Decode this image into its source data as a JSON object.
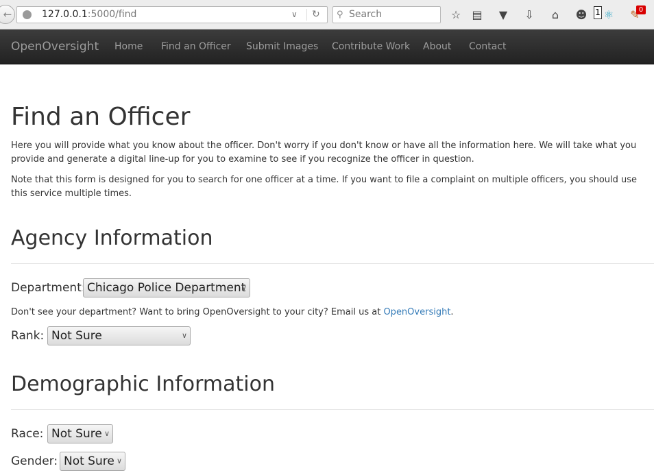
{
  "browser": {
    "url_host": "127.0.0.1",
    "url_rest": ":5000/find",
    "search_placeholder": "Search",
    "tab_count_badge": "1",
    "notification_badge": "0",
    "icons": [
      "back-icon",
      "globe-icon",
      "dropdown-icon",
      "reload-icon",
      "search-icon",
      "star-icon",
      "reader-icon",
      "pocket-icon",
      "download-icon",
      "home-icon",
      "chat-icon",
      "extension-icon",
      "notification-icon"
    ]
  },
  "navbar": {
    "brand": "OpenOversight",
    "items": [
      {
        "label": "Home"
      },
      {
        "label": "Find an Officer"
      },
      {
        "label": "Submit Images"
      },
      {
        "label": "Contribute Work"
      },
      {
        "label": "About"
      },
      {
        "label": "Contact"
      }
    ]
  },
  "page": {
    "title": "Find an Officer",
    "intro1": "Here you will provide what you know about the officer. Don't worry if you don't know or have all the information here. We will take what you provide and generate a digital line-up for you to examine to see if you recognize the officer in question.",
    "intro2": "Note that this form is designed for you to search for one officer at a time. If you want to file a complaint on multiple officers, you should use this service multiple times.",
    "agency_heading": "Agency Information",
    "department_label": "Department:",
    "department_value": "Chicago Police Department",
    "dept_note_prefix": "Don't see your department? Want to bring OpenOversight to your city? Email us at ",
    "dept_note_link": "OpenOversight",
    "dept_note_suffix": ".",
    "rank_label": "Rank:",
    "rank_value": "Not Sure",
    "demographic_heading": "Demographic Information",
    "race_label": "Race:",
    "race_value": "Not Sure",
    "gender_label": "Gender:",
    "gender_value": "Not Sure"
  }
}
